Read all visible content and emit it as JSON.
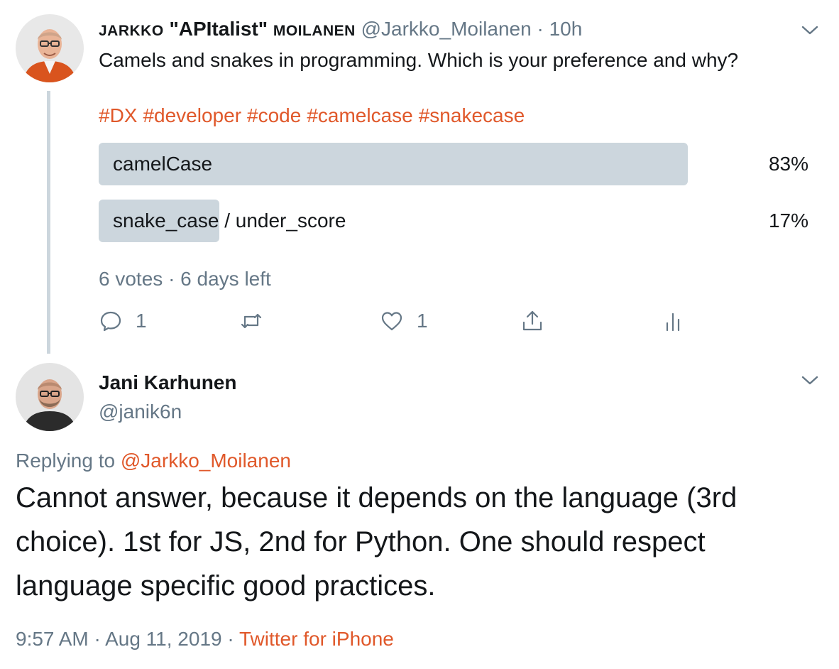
{
  "tweet": {
    "author_name_first": "Jarkko",
    "author_name_mid": " \"APItalist\" ",
    "author_name_last": "Moilanen",
    "handle": "@Jarkko_Moilanen",
    "separator": "·",
    "time": "10h",
    "text": "Camels and snakes in programming. Which is your preference and why?",
    "hashtags": [
      "#DX",
      "#developer",
      "#code",
      "#camelcase",
      "#snakecase"
    ],
    "poll": {
      "options": [
        {
          "label": "camelCase",
          "percent_text": "83%",
          "fraction": 0.83
        },
        {
          "label": "snake_case / under_score",
          "percent_text": "17%",
          "fraction": 0.17
        }
      ],
      "votes": "6 votes",
      "separator": "·",
      "time_left": "6 days left"
    },
    "actions": {
      "reply_count": "1",
      "like_count": "1"
    }
  },
  "reply": {
    "author_name": "Jani Karhunen",
    "handle": "@janik6n",
    "replying_prefix": "Replying to",
    "replying_mention": "@Jarkko_Moilanen",
    "text": "Cannot answer, because it depends on the language (3rd choice). 1st for JS, 2nd for Python. One should respect language specific good practices.",
    "timestamp_time": "9:57 AM",
    "separator": "·",
    "timestamp_date": "Aug 11, 2019",
    "source": "Twitter for iPhone"
  },
  "colors": {
    "accent": "#e0582a",
    "muted": "#657786",
    "poll_bar": "#ccd6dd",
    "text": "#14171a"
  },
  "icons": [
    "chevron-down-icon",
    "reply-icon",
    "retweet-icon",
    "like-icon",
    "share-icon",
    "analytics-icon"
  ]
}
